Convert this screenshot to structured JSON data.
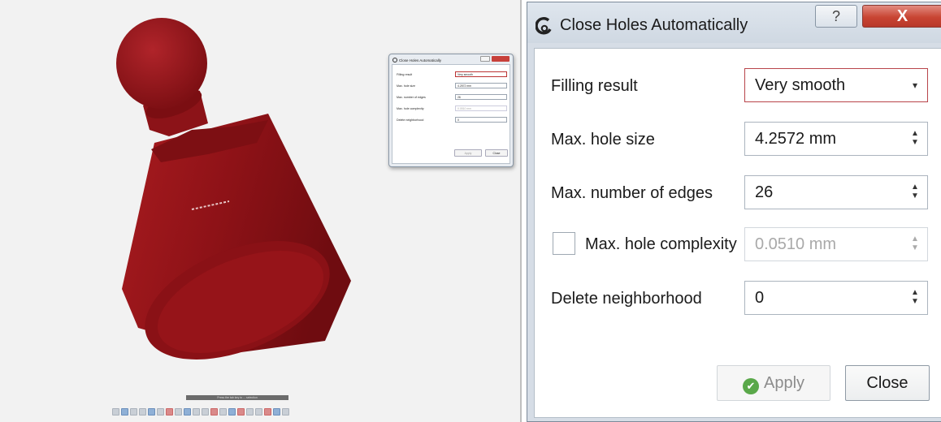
{
  "dialog": {
    "title": "Close Holes Automatically",
    "help_glyph": "?",
    "close_glyph": "X",
    "rows": {
      "filling_result": {
        "label": "Filling result",
        "value": "Very smooth"
      },
      "max_hole_size": {
        "label": "Max. hole size",
        "value": "4.2572 mm"
      },
      "max_edges": {
        "label": "Max. number of edges",
        "value": "26"
      },
      "max_complexity": {
        "label": "Max. hole complexity",
        "value": "0.0510 mm",
        "checked": false
      },
      "delete_neighborhood": {
        "label": "Delete neighborhood",
        "value": "0"
      }
    },
    "apply_label": "Apply",
    "close_label": "Close"
  },
  "viewport": {
    "model_color": "#8e1217",
    "tooltip": "Press the tab key to ... selection"
  },
  "icons": {
    "combo_arrow": "▾",
    "spin_up": "▲",
    "spin_down": "▼",
    "apply_check": "✔"
  }
}
